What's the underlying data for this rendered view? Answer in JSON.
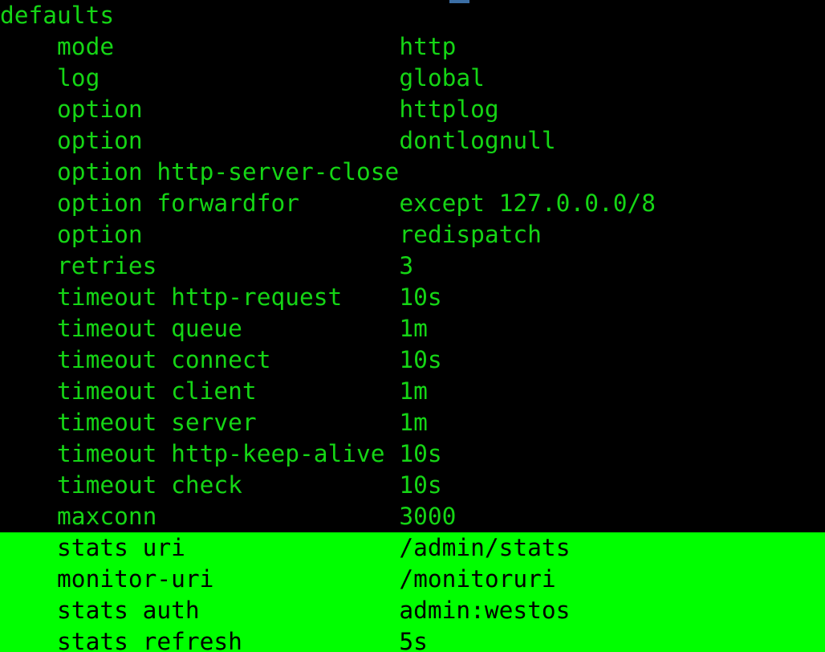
{
  "terminal": {
    "background_color": "#000000",
    "text_color": "#15d515",
    "highlight_background_color": "#00ff00",
    "highlight_text_color": "#000000",
    "top_fragment_color": "#3b6ea5",
    "section_header": "defaults",
    "indent": "    ",
    "key_column_width": 24
  },
  "config": {
    "lines": [
      {
        "indent": "",
        "key": "defaults",
        "value": "",
        "highlight": false
      },
      {
        "indent": "    ",
        "key": "mode",
        "value": "http",
        "highlight": false
      },
      {
        "indent": "    ",
        "key": "log",
        "value": "global",
        "highlight": false
      },
      {
        "indent": "    ",
        "key": "option",
        "value": "httplog",
        "highlight": false
      },
      {
        "indent": "    ",
        "key": "option",
        "value": "dontlognull",
        "highlight": false
      },
      {
        "indent": "    ",
        "key": "option http-server-close",
        "value": "",
        "highlight": false
      },
      {
        "indent": "    ",
        "key": "option forwardfor",
        "value": "except 127.0.0.0/8",
        "highlight": false
      },
      {
        "indent": "    ",
        "key": "option",
        "value": "redispatch",
        "highlight": false
      },
      {
        "indent": "    ",
        "key": "retries",
        "value": "3",
        "highlight": false
      },
      {
        "indent": "    ",
        "key": "timeout http-request",
        "value": "10s",
        "highlight": false
      },
      {
        "indent": "    ",
        "key": "timeout queue",
        "value": "1m",
        "highlight": false
      },
      {
        "indent": "    ",
        "key": "timeout connect",
        "value": "10s",
        "highlight": false
      },
      {
        "indent": "    ",
        "key": "timeout client",
        "value": "1m",
        "highlight": false
      },
      {
        "indent": "    ",
        "key": "timeout server",
        "value": "1m",
        "highlight": false
      },
      {
        "indent": "    ",
        "key": "timeout http-keep-alive",
        "value": "10s",
        "highlight": false
      },
      {
        "indent": "    ",
        "key": "timeout check",
        "value": "10s",
        "highlight": false
      },
      {
        "indent": "    ",
        "key": "maxconn",
        "value": "3000",
        "highlight": false
      },
      {
        "indent": "    ",
        "key": "stats uri",
        "value": "/admin/stats",
        "highlight": true
      },
      {
        "indent": "    ",
        "key": "monitor-uri",
        "value": "/monitoruri",
        "highlight": true
      },
      {
        "indent": "    ",
        "key": "stats auth",
        "value": "admin:westos",
        "highlight": true
      },
      {
        "indent": "    ",
        "key": "stats refresh",
        "value": "5s",
        "highlight": true
      }
    ]
  }
}
